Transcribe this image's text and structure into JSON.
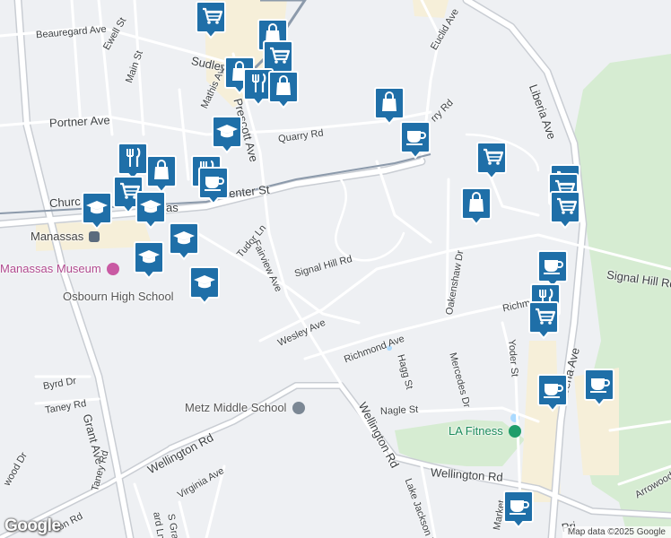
{
  "streets": {
    "beauregard": "Beauregard Ave",
    "ewell": "Ewell St",
    "main": "Main St",
    "mathis": "Mathis Ave",
    "sudley": "Sudley",
    "portner": "Portner Ave",
    "prescott": "Prescott Ave",
    "quarry1": "Quarry Rd",
    "quarry2": "rry Rd",
    "euclid": "Euclid Ave",
    "liberia_top": "Liberia Ave",
    "center": "enter St",
    "church": "Churc",
    "manassas_frag": "ssas",
    "tudor": "Tudor Ln",
    "fairview": "Fairview Ave",
    "signal_hill": "Signal Hill Rd",
    "signal_hill_right": "Signal Hill Rd",
    "oakenshaw": "Oakenshaw Dr",
    "richmond_right": "Richmon",
    "wesley": "Wesley Ave",
    "richmond": "Richmond Ave",
    "hagg": "Hagg St",
    "mercedes": "Mercedes Dr",
    "yoder": "Yoder St",
    "liberia_bottom": "Liberia Ave",
    "byrd": "Byrd Dr",
    "taney_dr": "Taney Rd",
    "grant": "Grant Ave",
    "wellington_main": "Wellington Rd",
    "nagle": "Nagle St",
    "wellington_left": "Wellington Rd",
    "wellington_right": "Wellington Rd",
    "taney_rd": "Taney Rd",
    "virginia": "Virginia Ave",
    "wood": "wood Dr",
    "lake_jackson": "Lake Jackson Dr",
    "arrowood": "Arrowood D",
    "s_grant": "S Grant",
    "ard": "ard Ln",
    "ton_rd": "ton Rd",
    "market": "Market",
    "pri": "Pri"
  },
  "places": {
    "manassas": "Manassas",
    "museum": "Manassas Museum",
    "osbourn": "Osbourn High School",
    "metz": "Metz Middle School",
    "la_fitness": "LA Fitness"
  },
  "markers": [
    {
      "icon": "cart-icon",
      "label": "Shopping"
    },
    {
      "icon": "shopping-bag-icon",
      "label": "Store"
    },
    {
      "icon": "cart-icon",
      "label": "Shopping"
    },
    {
      "icon": "shopping-bag-icon",
      "label": "Store"
    },
    {
      "icon": "restaurant-icon",
      "label": "Restaurant"
    },
    {
      "icon": "shopping-bag-icon",
      "label": "Store"
    },
    {
      "icon": "shopping-bag-icon",
      "label": "Store"
    },
    {
      "icon": "graduation-cap-icon",
      "label": "School"
    },
    {
      "icon": "coffee-cup-icon",
      "label": "Cafe"
    },
    {
      "icon": "restaurant-icon",
      "label": "Restaurant"
    },
    {
      "icon": "cart-icon",
      "label": "Shopping"
    },
    {
      "icon": "shopping-bag-icon",
      "label": "Store"
    },
    {
      "icon": "restaurant-icon",
      "label": "Restaurant"
    },
    {
      "icon": "coffee-cup-icon",
      "label": "Cafe"
    },
    {
      "icon": "cart-icon",
      "label": "Shopping"
    },
    {
      "icon": "graduation-cap-icon",
      "label": "School"
    },
    {
      "icon": "graduation-cap-icon",
      "label": "School"
    },
    {
      "icon": "graduation-cap-icon",
      "label": "School"
    },
    {
      "icon": "graduation-cap-icon",
      "label": "School"
    },
    {
      "icon": "graduation-cap-icon",
      "label": "School"
    },
    {
      "icon": "cart-icon",
      "label": "Shopping"
    },
    {
      "icon": "shopping-bag-icon",
      "label": "Store"
    },
    {
      "icon": "cart-icon",
      "label": "Shopping"
    },
    {
      "icon": "cart-icon",
      "label": "Shopping"
    },
    {
      "icon": "coffee-cup-icon",
      "label": "Cafe"
    },
    {
      "icon": "restaurant-icon",
      "label": "Restaurant"
    },
    {
      "icon": "cart-icon",
      "label": "Shopping"
    },
    {
      "icon": "coffee-cup-icon",
      "label": "Cafe"
    },
    {
      "icon": "coffee-cup-icon",
      "label": "Cafe"
    },
    {
      "icon": "coffee-cup-icon",
      "label": "Cafe"
    }
  ],
  "attribution": "Map data ©2025 Google",
  "logo": "Google",
  "colors": {
    "background": "#eef0f3",
    "road": "#ffffff",
    "road_outline": "#c9cdd3",
    "railway": "#8c9aab",
    "park": "#d6ecd2",
    "commercial": "#f6efd9",
    "marker": "#1f6fa8",
    "marker_border": "#ffffff"
  }
}
